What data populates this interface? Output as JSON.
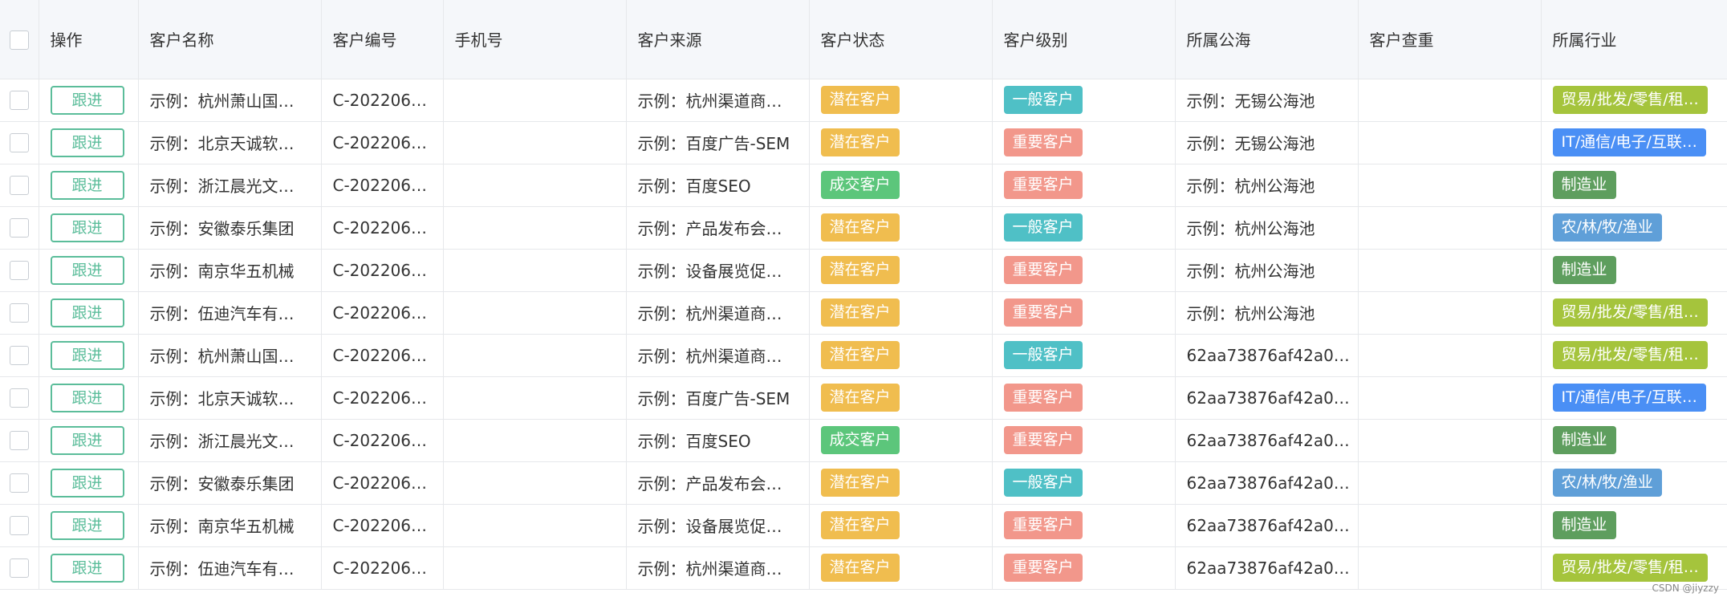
{
  "table": {
    "select_all_checked": false,
    "headers": [
      "操作",
      "客户名称",
      "客户编号",
      "手机号",
      "客户来源",
      "客户状态",
      "客户级别",
      "所属公海",
      "客户查重",
      "所属行业"
    ],
    "follow_label": "跟进",
    "rows": [
      {
        "name": "示例：杭州萧山国…",
        "code": "C-202206…",
        "phone": "",
        "source": "示例：杭州渠道商…",
        "status": "潜在客户",
        "level": "一般客户",
        "pool": "示例：无锡公海池",
        "dup": "",
        "industry": "贸易/批发/零售/租…"
      },
      {
        "name": "示例：北京天诚软…",
        "code": "C-202206…",
        "phone": "",
        "source": "示例：百度广告-SEM",
        "status": "潜在客户",
        "level": "重要客户",
        "pool": "示例：无锡公海池",
        "dup": "",
        "industry": "IT/通信/电子/互联…"
      },
      {
        "name": "示例：浙江晨光文…",
        "code": "C-202206…",
        "phone": "",
        "source": "示例：百度SEO",
        "status": "成交客户",
        "level": "重要客户",
        "pool": "示例：杭州公海池",
        "dup": "",
        "industry": "制造业"
      },
      {
        "name": "示例：安徽泰乐集团",
        "code": "C-202206…",
        "phone": "",
        "source": "示例：产品发布会…",
        "status": "潜在客户",
        "level": "一般客户",
        "pool": "示例：杭州公海池",
        "dup": "",
        "industry": "农/林/牧/渔业"
      },
      {
        "name": "示例：南京华五机械",
        "code": "C-202206…",
        "phone": "",
        "source": "示例：设备展览促…",
        "status": "潜在客户",
        "level": "重要客户",
        "pool": "示例：杭州公海池",
        "dup": "",
        "industry": "制造业"
      },
      {
        "name": "示例：伍迪汽车有…",
        "code": "C-202206…",
        "phone": "",
        "source": "示例：杭州渠道商…",
        "status": "潜在客户",
        "level": "重要客户",
        "pool": "示例：杭州公海池",
        "dup": "",
        "industry": "贸易/批发/零售/租…"
      },
      {
        "name": "示例：杭州萧山国…",
        "code": "C-202206…",
        "phone": "",
        "source": "示例：杭州渠道商…",
        "status": "潜在客户",
        "level": "一般客户",
        "pool": "62aa73876af42a0…",
        "dup": "",
        "industry": "贸易/批发/零售/租…"
      },
      {
        "name": "示例：北京天诚软…",
        "code": "C-202206…",
        "phone": "",
        "source": "示例：百度广告-SEM",
        "status": "潜在客户",
        "level": "重要客户",
        "pool": "62aa73876af42a0…",
        "dup": "",
        "industry": "IT/通信/电子/互联…"
      },
      {
        "name": "示例：浙江晨光文…",
        "code": "C-202206…",
        "phone": "",
        "source": "示例：百度SEO",
        "status": "成交客户",
        "level": "重要客户",
        "pool": "62aa73876af42a0…",
        "dup": "",
        "industry": "制造业"
      },
      {
        "name": "示例：安徽泰乐集团",
        "code": "C-202206…",
        "phone": "",
        "source": "示例：产品发布会…",
        "status": "潜在客户",
        "level": "一般客户",
        "pool": "62aa73876af42a0…",
        "dup": "",
        "industry": "农/林/牧/渔业"
      },
      {
        "name": "示例：南京华五机械",
        "code": "C-202206…",
        "phone": "",
        "source": "示例：设备展览促…",
        "status": "潜在客户",
        "level": "重要客户",
        "pool": "62aa73876af42a0…",
        "dup": "",
        "industry": "制造业"
      },
      {
        "name": "示例：伍迪汽车有…",
        "code": "C-202206…",
        "phone": "",
        "source": "示例：杭州渠道商…",
        "status": "潜在客户",
        "level": "重要客户",
        "pool": "62aa73876af42a0…",
        "dup": "",
        "industry": "贸易/批发/零售/租…"
      }
    ]
  },
  "tag_colors": {
    "潜在客户": "#f0bd4f",
    "成交客户": "#5cc67b",
    "一般客户": "#4fc0c6",
    "重要客户": "#f2978b",
    "贸易/批发/零售/租…": "#a5c43c",
    "IT/通信/电子/互联…": "#4a8ff5",
    "制造业": "#5e9e5e",
    "农/林/牧/渔业": "#5f9fd8"
  },
  "watermark": "CSDN @jiyzzy"
}
